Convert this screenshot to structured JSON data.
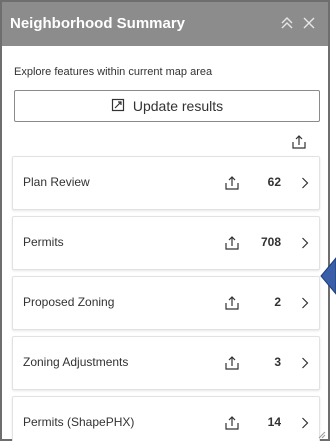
{
  "header": {
    "title": "Neighborhood Summary",
    "collapse_icon": "double-chevron-up-icon",
    "close_icon": "close-icon"
  },
  "body": {
    "subtitle": "Explore features within current map area",
    "update_button": {
      "label": "Update results",
      "icon": "refresh-extent-icon"
    },
    "export_all_icon": "export-icon"
  },
  "items": [
    {
      "label": "Plan Review",
      "count": "62"
    },
    {
      "label": "Permits",
      "count": "708"
    },
    {
      "label": "Proposed Zoning",
      "count": "2"
    },
    {
      "label": "Zoning Adjustments",
      "count": "3"
    },
    {
      "label": "Permits (ShapePHX)",
      "count": "14"
    }
  ],
  "colors": {
    "header_bg": "#8c8c8c",
    "panel_border": "#6e6e6e",
    "pointer_arrow": "#3a5fa8"
  }
}
